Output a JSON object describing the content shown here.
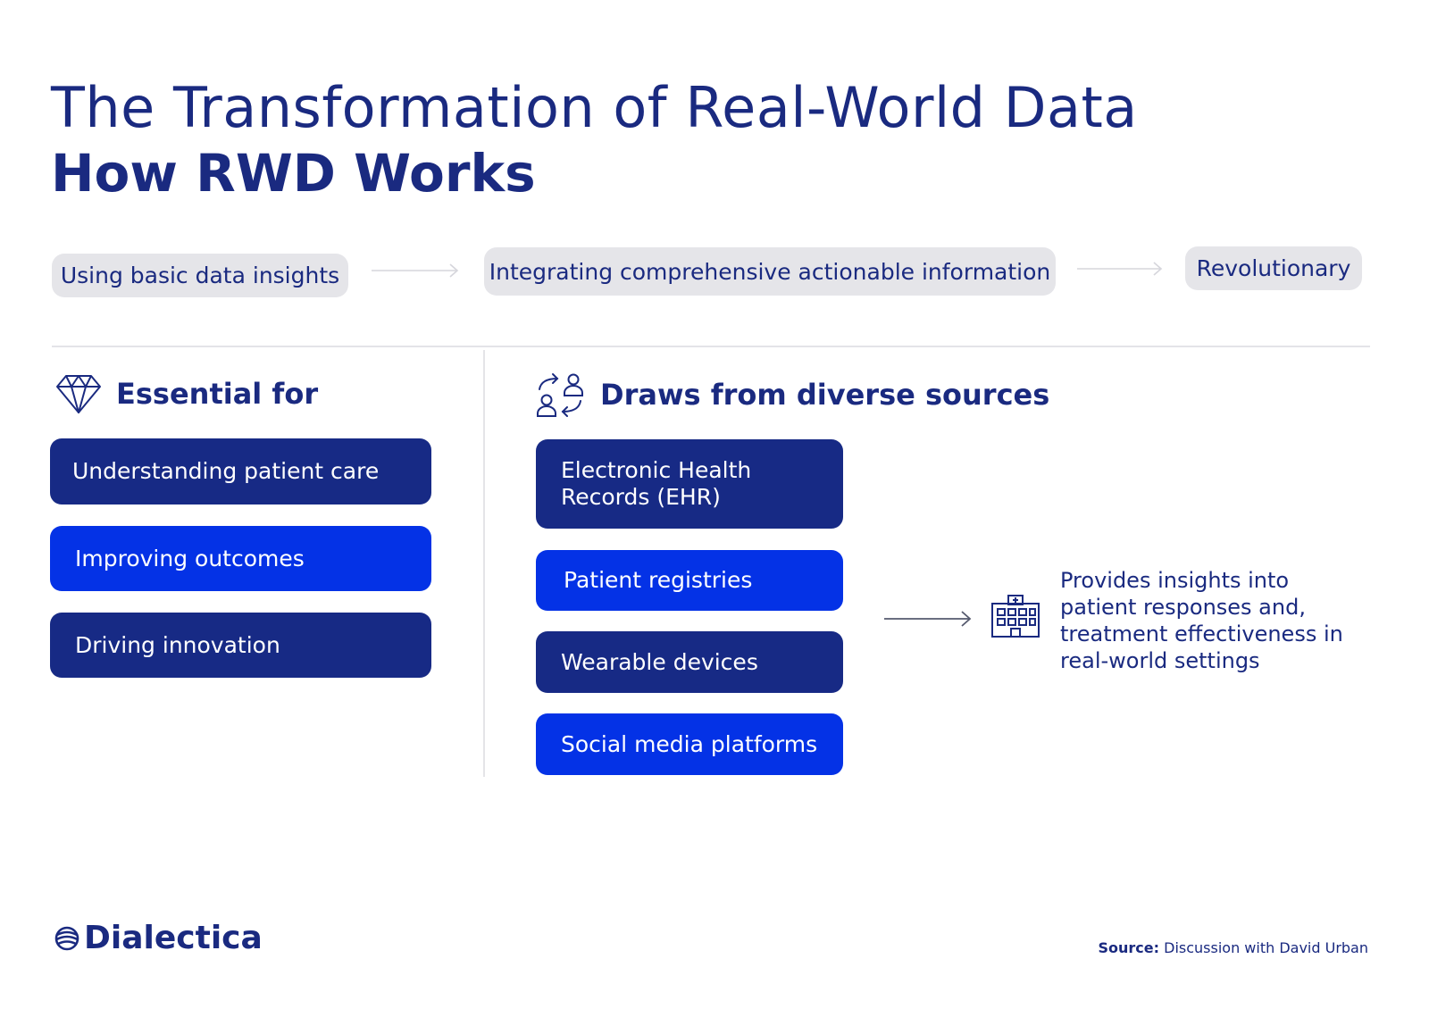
{
  "title": "The Transformation of Real-World Data",
  "subtitle": "How RWD Works",
  "flow": [
    {
      "label": "Using basic data insights"
    },
    {
      "label": "Integrating comprehensive actionable information"
    },
    {
      "label": "Revolutionary"
    }
  ],
  "essential": {
    "heading": "Essential for",
    "icon": "diamond-icon",
    "items": [
      {
        "label": "Understanding patient care"
      },
      {
        "label": "Improving outcomes"
      },
      {
        "label": "Driving innovation"
      }
    ]
  },
  "sources": {
    "heading": "Draws from diverse sources",
    "icon": "people-exchange-icon",
    "items": [
      {
        "label": "Electronic Health Records (EHR)"
      },
      {
        "label": "Patient registries"
      },
      {
        "label": "Wearable devices"
      },
      {
        "label": "Social media platforms"
      }
    ]
  },
  "result": {
    "icon": "hospital-icon",
    "text": "Provides insights into patient responses and, treatment effectiveness in real-world settings"
  },
  "footer": {
    "logo": "Dialectica",
    "source_label": "Source:",
    "source_text": "Discussion with David Urban"
  },
  "colors": {
    "navy": "#172a85",
    "blue": "#0432e6",
    "text": "#1a2a80",
    "pill": "#e5e5e9"
  }
}
